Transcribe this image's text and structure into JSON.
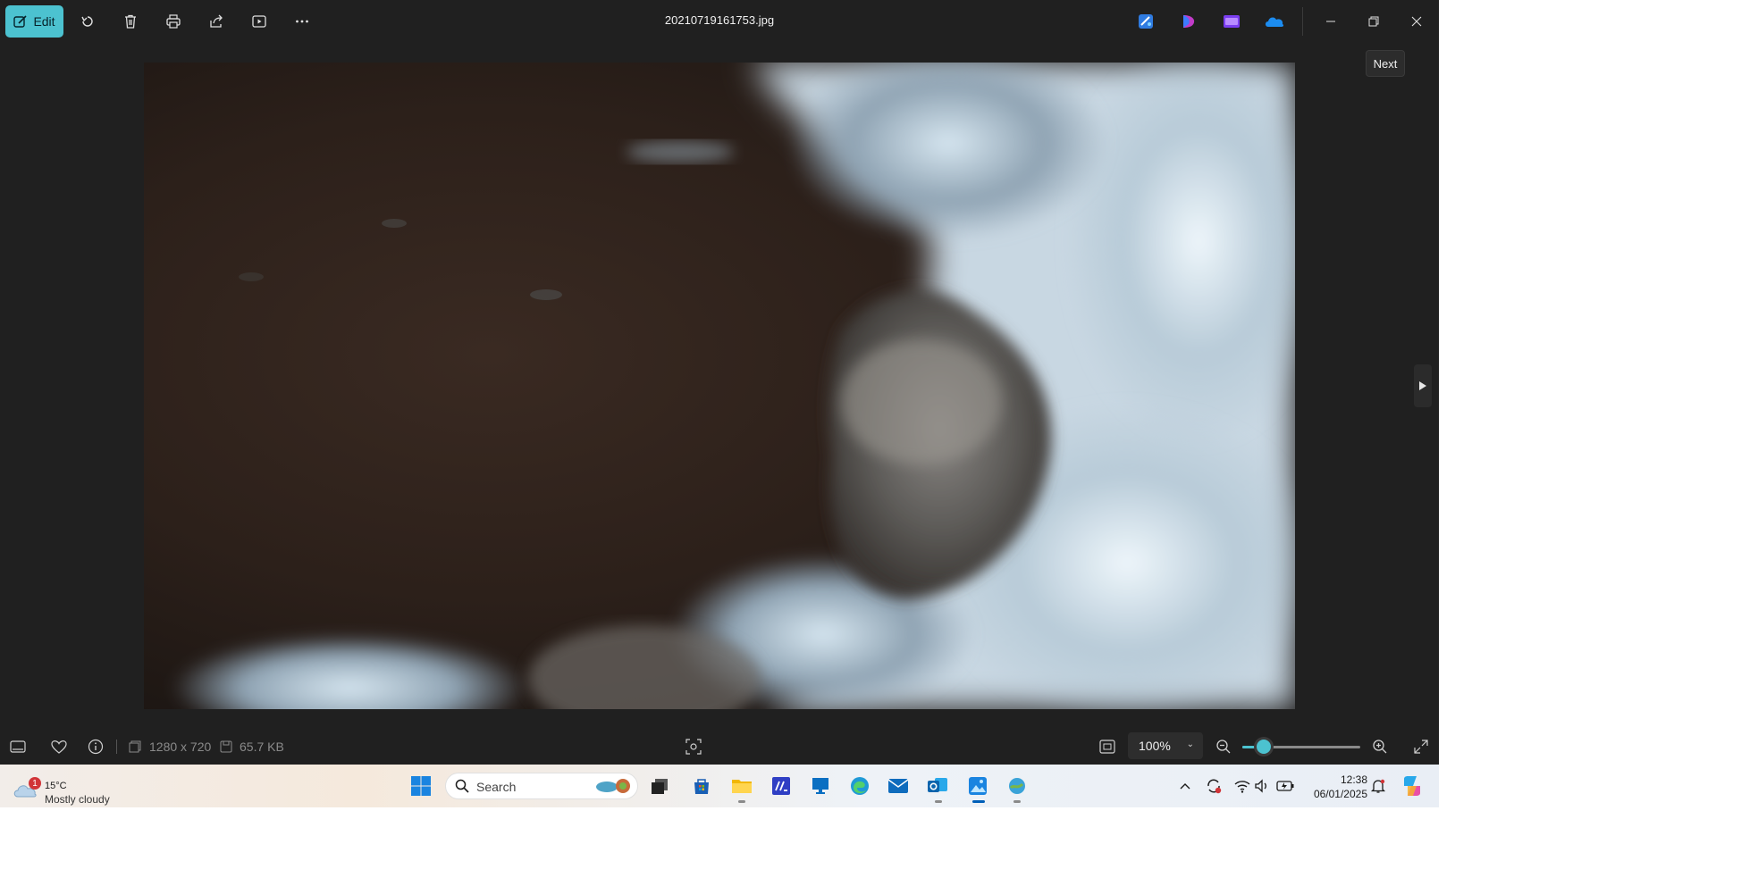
{
  "toolbar": {
    "edit_label": "Edit",
    "icons": [
      "rotate-icon",
      "delete-icon",
      "print-icon",
      "share-icon",
      "slideshow-icon",
      "more-options-icon"
    ],
    "file_name": "20210719161753.jpg",
    "apps": [
      "designer-icon",
      "clipchamp-icon",
      "video-editor-icon",
      "onedrive-icon"
    ],
    "window_controls": [
      "minimize-icon",
      "restore-icon",
      "close-icon"
    ]
  },
  "tooltip": {
    "text": "Next"
  },
  "status": {
    "dimensions": "1280 x 720",
    "file_size": "65.7 KB",
    "zoom_value": "100%",
    "zoom_slider_level": 0.18
  },
  "taskbar": {
    "weather_badge": "1",
    "weather_temp": "15°C",
    "weather_desc": "Mostly cloudy",
    "search_placeholder": "Search",
    "clock_time": "12:38",
    "clock_date": "06/01/2025"
  },
  "colors": {
    "accent": "#4cc2d0",
    "window_bg": "#202020",
    "taskbar_accent": "#005fb8"
  }
}
